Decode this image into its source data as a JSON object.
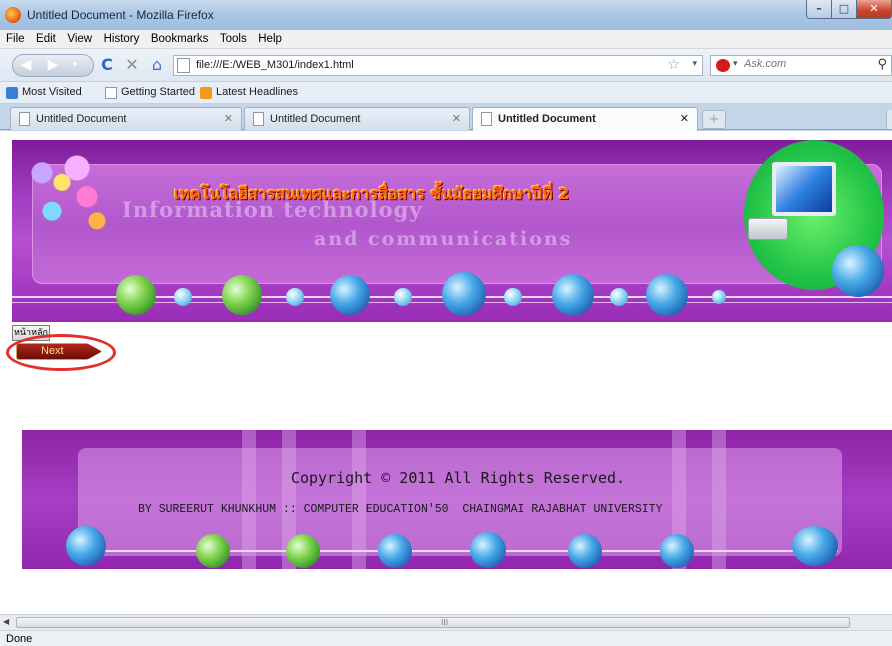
{
  "window": {
    "title": "Untitled Document - Mozilla Firefox"
  },
  "menu": [
    "File",
    "Edit",
    "View",
    "History",
    "Bookmarks",
    "Tools",
    "Help"
  ],
  "navbar": {
    "url": "file:///E:/WEB_M301/index1.html",
    "search_placeholder": "Ask.com"
  },
  "bookmarks": [
    "Most Visited",
    "Getting Started",
    "Latest Headlines"
  ],
  "tabs": [
    {
      "label": "Untitled Document",
      "active": false
    },
    {
      "label": "Untitled Document",
      "active": false
    },
    {
      "label": "Untitled Document",
      "active": true
    }
  ],
  "page": {
    "header": {
      "thai_title": "เทคโนโลยีสารสนเทศและการสื่อสาร ชั้นมัธยมศึกษาปีที่ 2",
      "ghost_line1": "Information technology",
      "ghost_line2": "and communications"
    },
    "home_button_label": "หน้าหลัก",
    "next_button_label": "Next",
    "footer": {
      "copyright": "Copyright © 2011 All Rights Reserved.",
      "byline": "BY SUREERUT KHUNKHUM :: COMPUTER EDUCATION'50  CHAINGMAI RAJABHAT UNIVERSITY"
    }
  },
  "status": {
    "text": "Done",
    "scroll_grip": "III"
  },
  "colors": {
    "banner_purple": "#a23cc0",
    "highlight_red": "#e42d2d",
    "title_orange": "#ff6a1a"
  }
}
